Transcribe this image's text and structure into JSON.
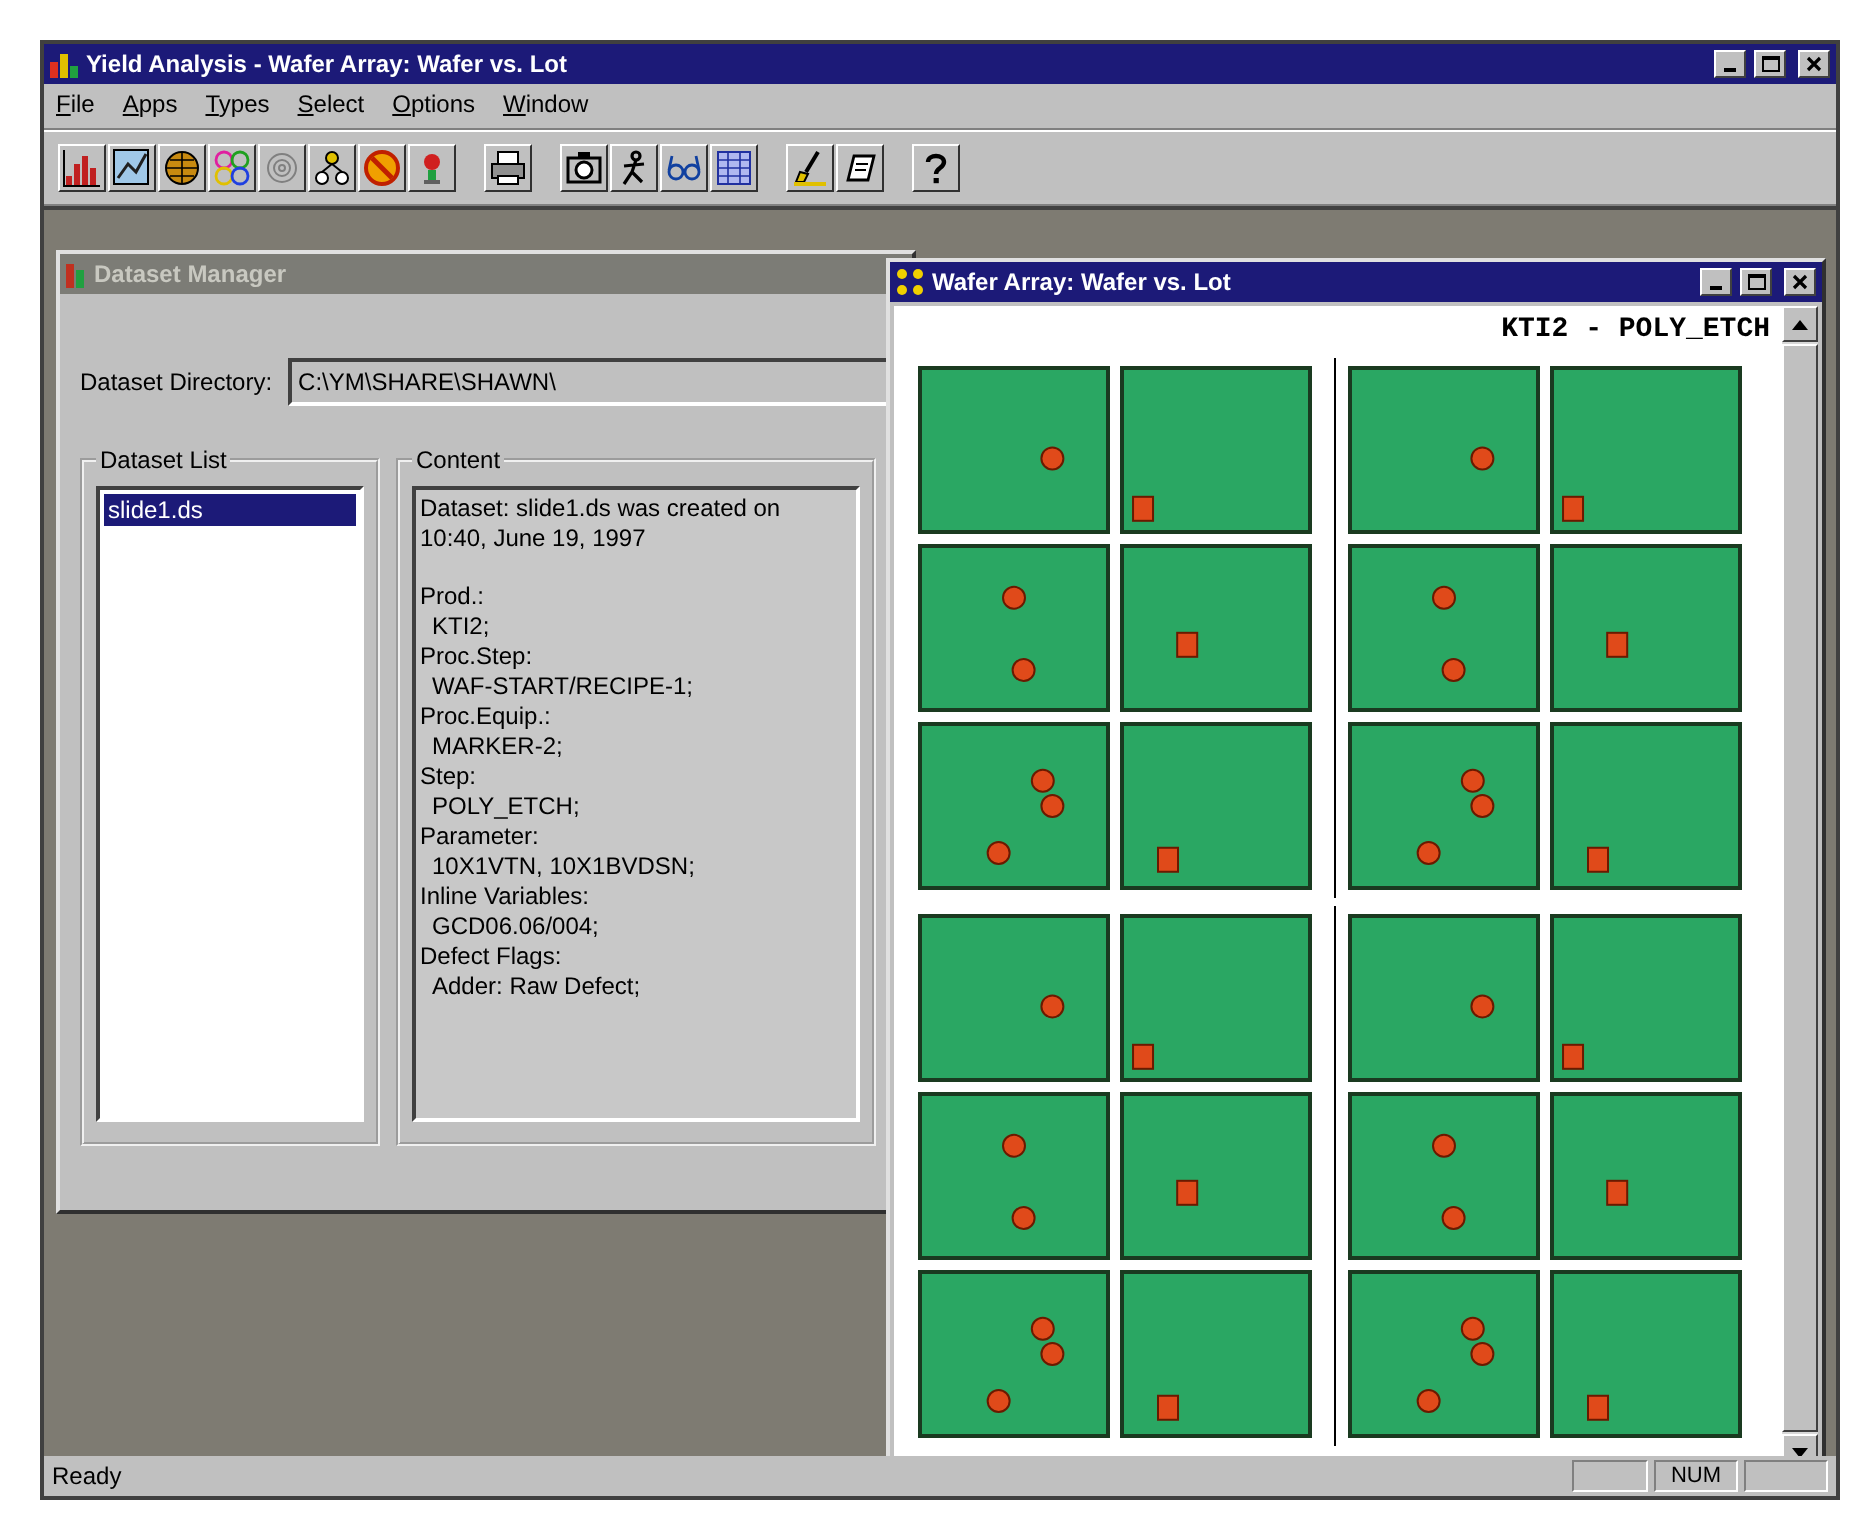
{
  "window": {
    "title": "Yield Analysis - Wafer Array: Wafer vs. Lot"
  },
  "menu": [
    "File",
    "Apps",
    "Types",
    "Select",
    "Options",
    "Window"
  ],
  "dataset_manager": {
    "title": "Dataset Manager",
    "directory_label": "Dataset Directory:",
    "directory": "C:\\YM\\SHARE\\SHAWN\\",
    "list_label": "Dataset List",
    "datasets": [
      {
        "label": "slide1.ds",
        "selected": true
      }
    ],
    "content_label": "Content",
    "content": [
      {
        "kind": "note",
        "text": "Dataset: slide1.ds was created on 10:40, June 19, 1997"
      },
      {
        "kind": "label",
        "text": "Prod.:"
      },
      {
        "kind": "value",
        "text": "KTI2;"
      },
      {
        "kind": "label",
        "text": "Proc.Step:"
      },
      {
        "kind": "value",
        "text": "WAF-START/RECIPE-1;"
      },
      {
        "kind": "label",
        "text": "Proc.Equip.:"
      },
      {
        "kind": "value",
        "text": "MARKER-2;"
      },
      {
        "kind": "label",
        "text": "Step:"
      },
      {
        "kind": "value",
        "text": "POLY_ETCH;"
      },
      {
        "kind": "label",
        "text": "Parameter:"
      },
      {
        "kind": "value",
        "text": "10X1VTN, 10X1BVDSN;"
      },
      {
        "kind": "label",
        "text": "Inline Variables:"
      },
      {
        "kind": "value",
        "text": "GCD06.06/004;"
      },
      {
        "kind": "label",
        "text": "Defect Flags:"
      },
      {
        "kind": "value",
        "text": "Adder: Raw Defect;"
      }
    ]
  },
  "wafer_array": {
    "title": "Wafer Array: Wafer vs. Lot",
    "heading": "KTI2 - POLY_ETCH"
  },
  "status_bar": {
    "message": "Ready",
    "indicator": "NUM"
  }
}
